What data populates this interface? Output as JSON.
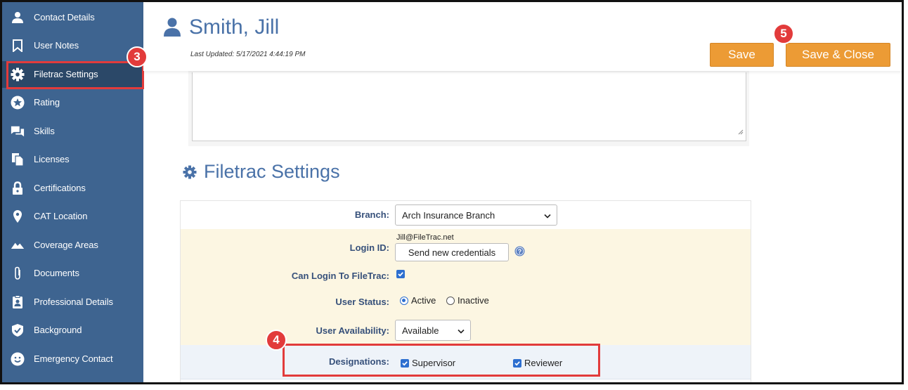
{
  "sidebar": {
    "items": [
      {
        "label": "Contact Details",
        "icon": "person-icon"
      },
      {
        "label": "User Notes",
        "icon": "bookmark-icon"
      },
      {
        "label": "Filetrac Settings",
        "icon": "gear-icon"
      },
      {
        "label": "Rating",
        "icon": "star-icon"
      },
      {
        "label": "Skills",
        "icon": "chat-icon"
      },
      {
        "label": "Licenses",
        "icon": "document-copy-icon"
      },
      {
        "label": "Certifications",
        "icon": "lock-icon"
      },
      {
        "label": "CAT Location",
        "icon": "map-pin-icon"
      },
      {
        "label": "Coverage Areas",
        "icon": "mountain-icon"
      },
      {
        "label": "Documents",
        "icon": "paperclip-icon"
      },
      {
        "label": "Professional Details",
        "icon": "id-badge-icon"
      },
      {
        "label": "Background",
        "icon": "shield-check-icon"
      },
      {
        "label": "Emergency Contact",
        "icon": "smile-icon"
      }
    ],
    "active_index": 2
  },
  "header": {
    "title": "Smith, Jill",
    "last_updated": "Last Updated: 5/17/2021 4:44:19 PM",
    "save_label": "Save",
    "save_close_label": "Save & Close"
  },
  "section": {
    "title": "Filetrac Settings"
  },
  "form": {
    "branch_label": "Branch:",
    "branch_value": "Arch Insurance Branch",
    "login_id_label": "Login ID:",
    "login_id_value": "Jill@FileTrac.net",
    "send_credentials_label": "Send new credentials",
    "can_login_label": "Can Login To FileTrac:",
    "can_login_checked": true,
    "user_status_label": "User Status:",
    "status_active_label": "Active",
    "status_inactive_label": "Inactive",
    "status_selected": "Active",
    "availability_label": "User Availability:",
    "availability_value": "Available",
    "designations_label": "Designations:",
    "designation_supervisor_label": "Supervisor",
    "designation_reviewer_label": "Reviewer"
  },
  "callouts": {
    "step3": "3",
    "step4": "4",
    "step5": "5"
  },
  "colors": {
    "sidebar": "#3e6490",
    "sidebar_active": "#2b4868",
    "accent_orange": "#ec9b35",
    "title_blue": "#4a72a8",
    "highlight_red": "#e23b3b",
    "row_yellow": "#fcf6e2"
  }
}
